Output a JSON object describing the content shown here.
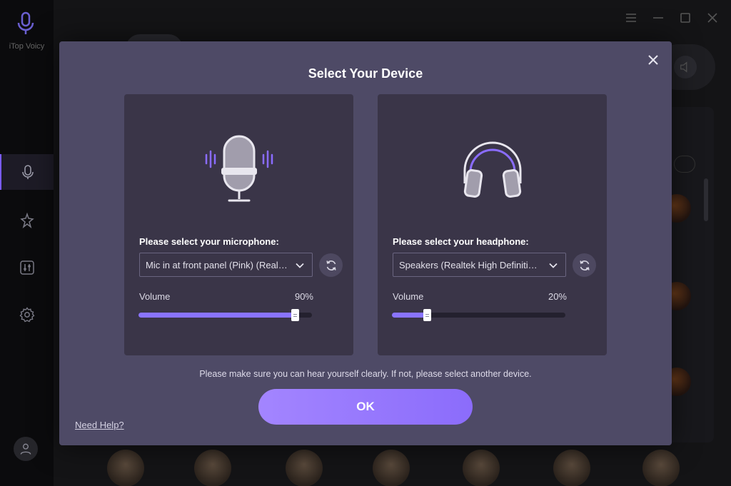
{
  "app": {
    "name": "iTop Voicy"
  },
  "modal": {
    "title": "Select Your Device",
    "hint": "Please make sure you can hear yourself clearly. If not, please select another device.",
    "ok_label": "OK",
    "help_label": "Need Help?"
  },
  "microphone": {
    "label": "Please select your microphone:",
    "selected": "Mic in at front panel (Pink) (Realtek High Definition Audio)",
    "volume_label": "Volume",
    "volume_text": "90%",
    "volume": 0.9
  },
  "headphone": {
    "label": "Please select your headphone:",
    "selected": "Speakers (Realtek High Definition Audio)",
    "volume_label": "Volume",
    "volume_text": "20%",
    "volume": 0.2
  },
  "icons": {
    "close": "close-icon",
    "chevron": "chevron-down-icon",
    "refresh": "refresh-icon",
    "microphone": "microphone-icon",
    "headphones": "headphones-icon"
  },
  "colors": {
    "accent": "#8a74ff",
    "modal_bg": "#4e4a66",
    "card_bg": "#3a3548"
  }
}
